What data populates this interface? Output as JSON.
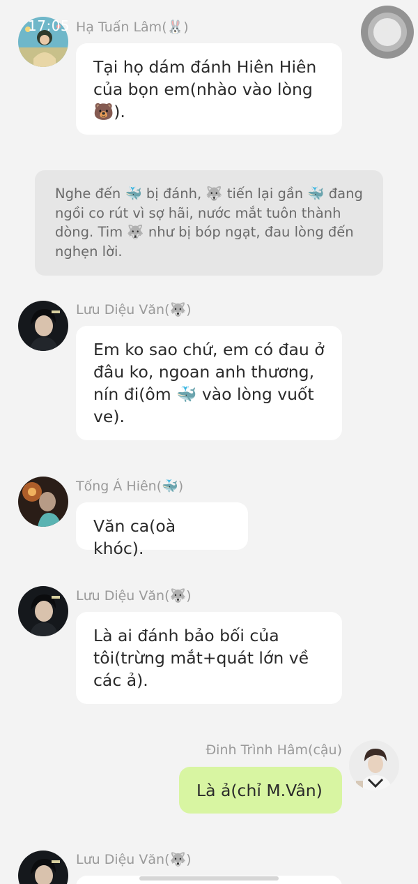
{
  "status_bar": {
    "time": "17:05"
  },
  "messages": [
    {
      "id": "m1",
      "sender": "Hạ Tuấn Lâm(🐰)",
      "text": "Tại họ dám đánh Hiên Hiên của bọn em(nhào vào lòng 🐻)."
    },
    {
      "id": "narr",
      "text": "Nghe đến 🐳 bị đánh, 🐺 tiến lại gần 🐳 đang ngồi co rút vì sợ hãi, nước mắt tuôn thành dòng. Tim 🐺 như bị bóp ngạt, đau lòng đến nghẹn lời."
    },
    {
      "id": "m2",
      "sender": "Lưu Diệu Văn(🐺)",
      "text": "Em ko sao chứ, em có đau ở đâu ko, ngoan anh thương, nín đi(ôm 🐳 vào lòng vuốt ve)."
    },
    {
      "id": "m3",
      "sender": "Tống Á Hiên(🐳)",
      "text": "Văn ca(oà khóc)."
    },
    {
      "id": "m4",
      "sender": "Lưu Diệu Văn(🐺)",
      "text": "Là ai đánh bảo bối của tôi(trừng mắt+quát lớn về các ả)."
    },
    {
      "id": "m5",
      "sender": "Đinh Trình Hâm(cậu)",
      "text": "Là ả(chỉ M.Vân)"
    },
    {
      "id": "m6",
      "sender": "Lưu Diệu Văn(🐺)",
      "text": ""
    }
  ],
  "colors": {
    "background": "#f3f3f3",
    "bubble_incoming": "#ffffff",
    "bubble_outgoing": "#d8f5a2",
    "narration_bg": "#e6e6e6",
    "name_text": "#9a9a9a"
  },
  "icons": {
    "battery": "battery-icon",
    "assistive_touch": "assistive-touch-icon"
  }
}
